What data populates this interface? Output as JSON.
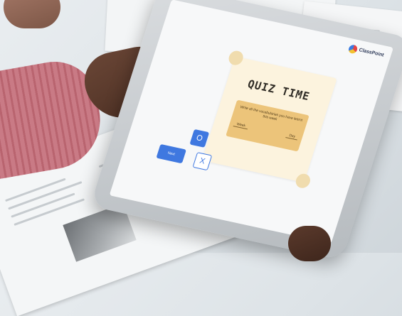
{
  "app": {
    "logo_name": "logo-icon",
    "logo_text": "ClassPoint"
  },
  "quiz": {
    "title": "QUIZ TIME",
    "instruction": "Write all the vocabularies you have learnt this week",
    "field_a": "Week",
    "field_b": "Day"
  },
  "buttons": {
    "o_label": "O",
    "x_label": "X",
    "next_label": "Next"
  },
  "colors": {
    "accent": "#3f78e0",
    "card": "#fcf3de",
    "card_box": "#ecc47a"
  }
}
